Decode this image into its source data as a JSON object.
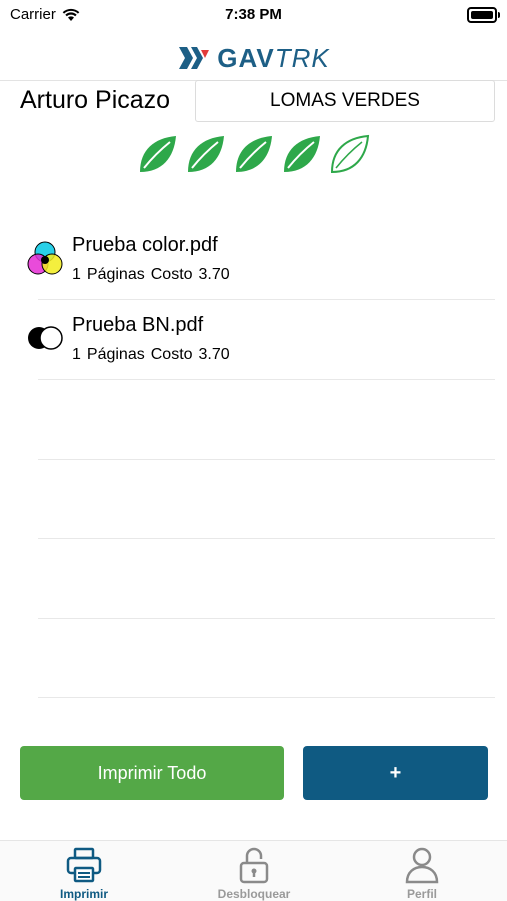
{
  "status": {
    "carrier": "Carrier",
    "time": "7:38 PM"
  },
  "brand": {
    "part1": "GAV",
    "part2": "TRK"
  },
  "user": {
    "name": "Arturo Picazo",
    "location": "LOMAS VERDES"
  },
  "eco_rating": {
    "filled": 4,
    "total": 5,
    "color": "#2ea84a"
  },
  "files": [
    {
      "name": "Prueba color.pdf",
      "pages": "1",
      "pages_label": "Páginas",
      "cost_label": "Costo",
      "cost": "3.70",
      "icon": "color-circles-icon"
    },
    {
      "name": "Prueba BN.pdf",
      "pages": "1",
      "pages_label": "Páginas",
      "cost_label": "Costo",
      "cost": "3.70",
      "icon": "bw-circles-icon"
    }
  ],
  "buttons": {
    "print_all": "Imprimir Todo",
    "add": "+"
  },
  "tabs": [
    {
      "label": "Imprimir",
      "icon": "printer-icon",
      "active": true
    },
    {
      "label": "Desbloquear",
      "icon": "lock-icon",
      "active": false
    },
    {
      "label": "Perfil",
      "icon": "person-icon",
      "active": false
    }
  ],
  "colors": {
    "accent": "#0f5a82",
    "green": "#54a847",
    "leaf": "#2ea84a"
  }
}
